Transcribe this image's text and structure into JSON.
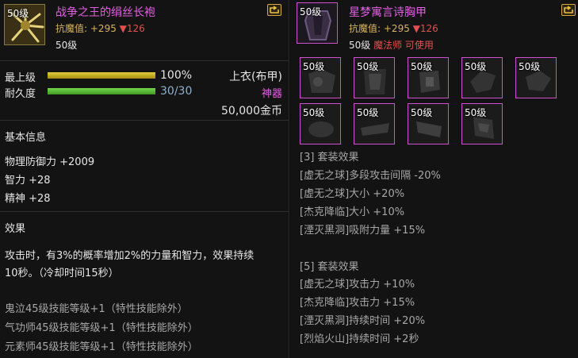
{
  "left": {
    "level_tag": "50级",
    "item_name": "战争之王的绢丝长袍",
    "kangmo_label": "抗魔值:",
    "kangmo_plus": "+295",
    "kangmo_minus": "▼126",
    "level_req": "50级",
    "max_level_label": "最上级",
    "max_level_value": "100%",
    "max_level_fraction": 1.0,
    "durability_label": "耐久度",
    "durability_value": "30/30",
    "durability_fraction": 1.0,
    "slot_type": "上衣(布甲)",
    "rarity": "神器",
    "price": "50,000金币",
    "basic_info_header": "基本信息",
    "stats": [
      "物理防御力 +2009",
      "智力 +28",
      "精神 +28"
    ],
    "effect_header": "效果",
    "effect_lines": [
      "攻击时，有3%的概率增加2%的力量和智力，效果持续",
      "10秒。（冷却时间15秒）"
    ],
    "skill_lines": [
      "鬼泣45级技能等级+1（特性技能除外）",
      "气功师45级技能等级+1（特性技能除外）",
      "元素师45级技能等级+1（特性技能除外）"
    ]
  },
  "right": {
    "level_tag": "50级",
    "item_name": "星梦寓言诗胸甲",
    "kangmo_label": "抗魔值:",
    "kangmo_plus": "+295",
    "kangmo_minus": "▼126",
    "level_req": "50级",
    "class_req": "魔法师 可使用",
    "set_items": [
      "50级",
      "50级",
      "50级",
      "50级",
      "50级",
      "50级",
      "50级",
      "50级",
      "50级"
    ],
    "set3_header": "[3] 套装效果",
    "set3_lines": [
      "[虚无之球]多段攻击间隔 -20%",
      "[虚无之球]大小 +20%",
      "[杰克降临]大小 +10%",
      "[湮灭黑洞]吸附力量 +15%"
    ],
    "set5_header": "[5] 套装效果",
    "set5_lines": [
      "[虚无之球]攻击力 +10%",
      "[杰克降临]攻击力 +15%",
      "[湮灭黑洞]持续时间 +20%",
      "[烈焰火山]持续时间 +2秒"
    ]
  },
  "colors": {
    "title": "#e45fe4",
    "gold": "#d9b55a",
    "down_red": "#e05050",
    "bar_yellow": "#c9b322",
    "bar_green": "#5fbf3a",
    "durability_text": "#8fb0d0"
  }
}
